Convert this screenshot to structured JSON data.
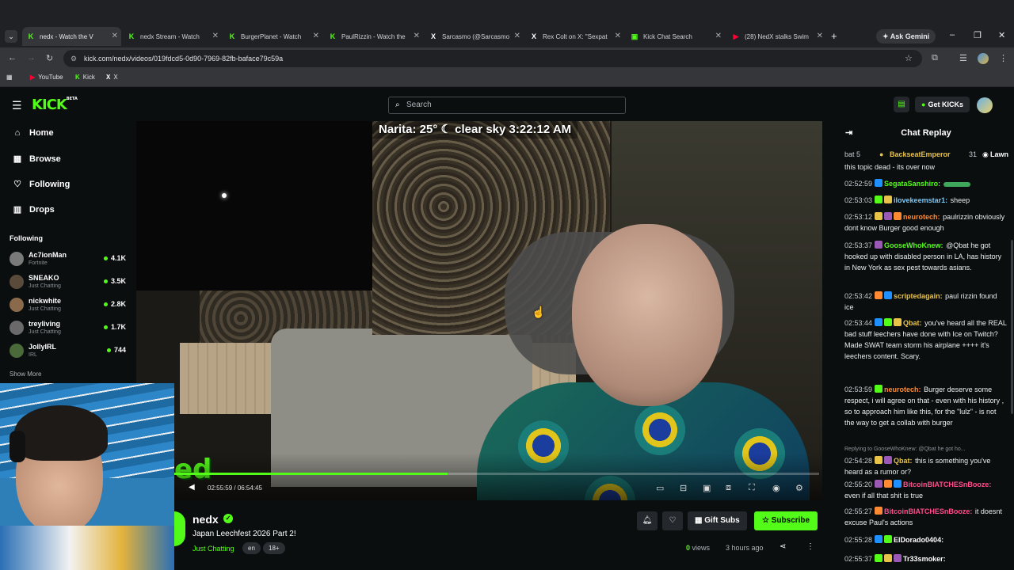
{
  "browser": {
    "tabs": [
      {
        "title": "nedx - Watch the V",
        "fav": "K",
        "color": "#53fc18",
        "active": true
      },
      {
        "title": "nedx Stream - Watch",
        "fav": "K",
        "color": "#53fc18"
      },
      {
        "title": "BurgerPlanet - Watch",
        "fav": "K",
        "color": "#53fc18"
      },
      {
        "title": "PaulRizzin - Watch the",
        "fav": "K",
        "color": "#53fc18"
      },
      {
        "title": "Sarcasmo (@Sarcasmo",
        "fav": "X",
        "color": "#ffffff"
      },
      {
        "title": "Rex Colt on X: \"Sexpat",
        "fav": "X",
        "color": "#ffffff"
      },
      {
        "title": "Kick Chat Search",
        "fav": "▣",
        "color": "#53fc18"
      },
      {
        "title": "(28) NedX stalks Swim",
        "fav": "▶",
        "color": "#ff0033"
      }
    ],
    "ask_gemini": "Ask Gemini",
    "url": "kick.com/nedx/videos/019fdcd5-0d90-7969-82fb-baface79c59a",
    "bookmarks": [
      {
        "label": "YouTube",
        "icon": "▶",
        "color": "#ff0033"
      },
      {
        "label": "Kick",
        "icon": "K",
        "color": "#53fc18"
      },
      {
        "label": "X",
        "icon": "X",
        "color": "#ffffff"
      }
    ]
  },
  "kick": {
    "logo": "KICK",
    "logo_badge": "BETA",
    "search_placeholder": "Search",
    "get_kicks": "Get KICKs",
    "accent": "#53fc18"
  },
  "sidebar": {
    "nav": [
      {
        "label": "Home",
        "icon": "⌂"
      },
      {
        "label": "Browse",
        "icon": "▦"
      },
      {
        "label": "Following",
        "icon": "♡"
      },
      {
        "label": "Drops",
        "icon": "▥"
      }
    ],
    "following_heading": "Following",
    "following": [
      {
        "name": "Ac7ionMan",
        "category": "Fortnite",
        "viewers": "4.1K",
        "color": "#7a7a7a"
      },
      {
        "name": "SNEAKO",
        "category": "Just Chatting",
        "viewers": "3.5K",
        "color": "#5a4a3a"
      },
      {
        "name": "nickwhite",
        "category": "Just Chatting",
        "viewers": "2.8K",
        "color": "#8a6a4a"
      },
      {
        "name": "treyliving",
        "category": "Just Chatting",
        "viewers": "1.7K",
        "color": "#6a6a6a"
      },
      {
        "name": "JollyIRL",
        "category": "IRL",
        "viewers": "744",
        "color": "#4a6a3a"
      }
    ],
    "show_more": "Show More"
  },
  "video": {
    "overlay_text": "Narita: 25° ☾ clear sky 3:22:12 AM",
    "time_current": "02:55:59",
    "time_total": "06:54:45",
    "progress_fraction": 0.424
  },
  "stream": {
    "channel": "nedx",
    "title": "Japan Leechfest 2026 Part 2!",
    "category": "Just Chatting",
    "tags": [
      "en",
      "18+"
    ],
    "gift_subs": "Gift Subs",
    "subscribe": "Subscribe",
    "views_count": "0",
    "views_label": "views",
    "ago": "3 hours ago"
  },
  "chat": {
    "title": "Chat Replay",
    "leaderboard": [
      {
        "text": "bat 5",
        "color": "#c7ccd1"
      },
      {
        "text": "BackseatEmperor",
        "count": "31",
        "color": "#e8c34a"
      },
      {
        "text": "Lawn",
        "color": "#ffffff"
      }
    ],
    "first_line": "this topic dead - its over now",
    "messages": [
      {
        "time": "02:52:59",
        "user": "SegataSanshiro:",
        "color": "#53fc18",
        "text": "",
        "emote": true
      },
      {
        "time": "02:53:03",
        "user": "ilovekeemstar1:",
        "color": "#7ec8f5",
        "text": "sheep"
      },
      {
        "time": "02:53:12",
        "user": "neurotech:",
        "color": "#ff8a33",
        "text": "paulrizzin obviously dont know Burger good enough"
      },
      {
        "time": "02:53:37",
        "user": "GooseWhoKnew:",
        "color": "#53fc18",
        "text": "@Qbat he got hooked up with disabled person in LA, has history in New York as sex pest towards asians."
      },
      {
        "time": "02:53:42",
        "user": "scriptedagain:",
        "color": "#e8c34a",
        "text": "paul rizzin found ice"
      },
      {
        "time": "02:53:44",
        "user": "Qbat:",
        "color": "#e8c34a",
        "text": "you've heard all the REAL bad stuff leechers have done with Ice on Twitch? Made SWAT team storm his airplane ++++ it's leechers content. Scary."
      },
      {
        "time": "02:53:59",
        "user": "neurotech:",
        "color": "#ff8a33",
        "text": "Burger deserve some respect, i will agree on that - even with his history , so to approach him like this, for the \"lulz\" - is not the way to get a collab with burger"
      },
      {
        "time": "02:54:28",
        "user": "Qbat:",
        "color": "#e8c34a",
        "text": "this is something you've heard as a rumor or?",
        "reply": "Replying to GooseWhoKnew: @Qbat he got ho..."
      },
      {
        "time": "02:55:20",
        "user": "BitcoinBIATCHESnBooze:",
        "color": "#ff4d8d",
        "text": "even if all that shit is true"
      },
      {
        "time": "02:55:27",
        "user": "BitcoinBIATCHESnBooze:",
        "color": "#ff4d8d",
        "text": "it doesnt excuse Paul's actions"
      },
      {
        "time": "02:55:28",
        "user": "ElDorado0404:",
        "color": "#ffffff",
        "text": ""
      },
      {
        "time": "02:55:37",
        "user": "Tr33smoker:",
        "color": "#ffffff",
        "text": ""
      }
    ]
  }
}
